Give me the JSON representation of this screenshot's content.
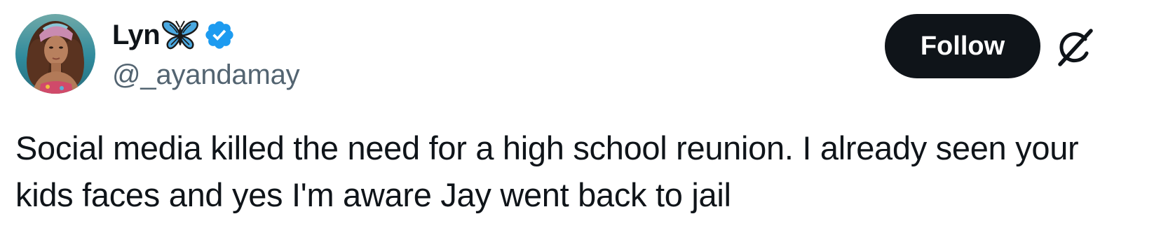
{
  "author": {
    "display_name": "Lyn",
    "handle": "@_ayandamay",
    "name_emoji": "butterfly-icon",
    "verified_badge": "verified-icon",
    "verified_color": "#1d9bf0"
  },
  "actions": {
    "follow_label": "Follow",
    "grok_icon": "grok-icon"
  },
  "tweet": {
    "text": "Social media killed the need for a high school reunion. I already seen your kids faces and yes I'm aware Jay went back to jail"
  },
  "colors": {
    "text": "#0f1419",
    "secondary_text": "#536471",
    "button_bg": "#0f1419",
    "button_text": "#ffffff",
    "butterfly": "#4aa8e0"
  }
}
